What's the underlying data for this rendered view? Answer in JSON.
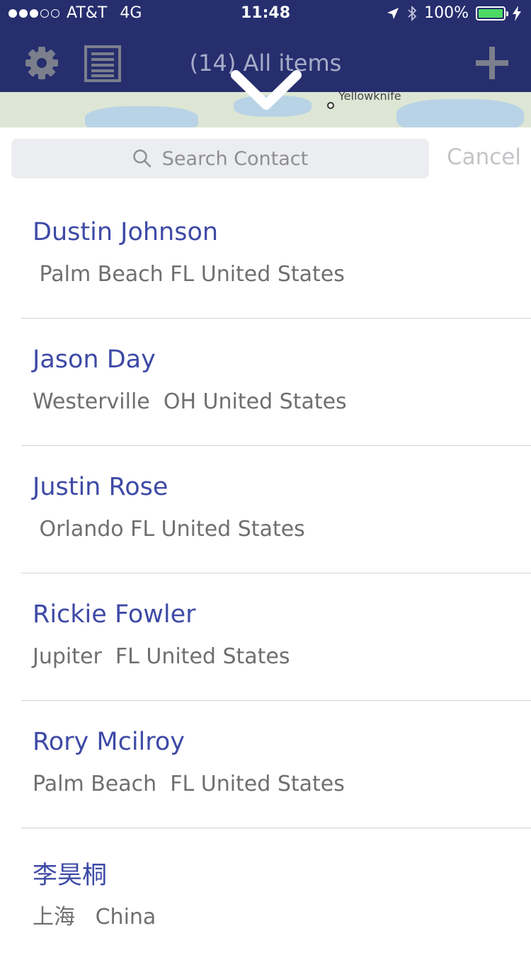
{
  "status_bar": {
    "carrier": "AT&T",
    "network": "4G",
    "time": "11:48",
    "battery": "100%",
    "signal_dots_filled": 3,
    "signal_dots_total": 5
  },
  "nav": {
    "title": "(14)  All items",
    "icons": [
      "gear-icon",
      "list-icon",
      "plus-icon"
    ]
  },
  "map": {
    "city_label": "Yellowknife"
  },
  "search": {
    "placeholder": "Search Contact",
    "cancel_label": "Cancel"
  },
  "contacts": [
    {
      "name": "Dustin Johnson",
      "address": " Palm Beach FL United States"
    },
    {
      "name": "Jason Day",
      "address": "Westerville  OH United States"
    },
    {
      "name": "Justin Rose",
      "address": " Orlando FL United States"
    },
    {
      "name": "Rickie Fowler",
      "address": "Jupiter  FL United States"
    },
    {
      "name": "Rory Mcilroy",
      "address": "Palm Beach  FL United States"
    },
    {
      "name": "李昊桐",
      "address": "上海   China"
    }
  ],
  "colors": {
    "nav_background": "#262e6e",
    "contact_name": "#3e4aa6",
    "battery_fill": "#4cd964"
  }
}
